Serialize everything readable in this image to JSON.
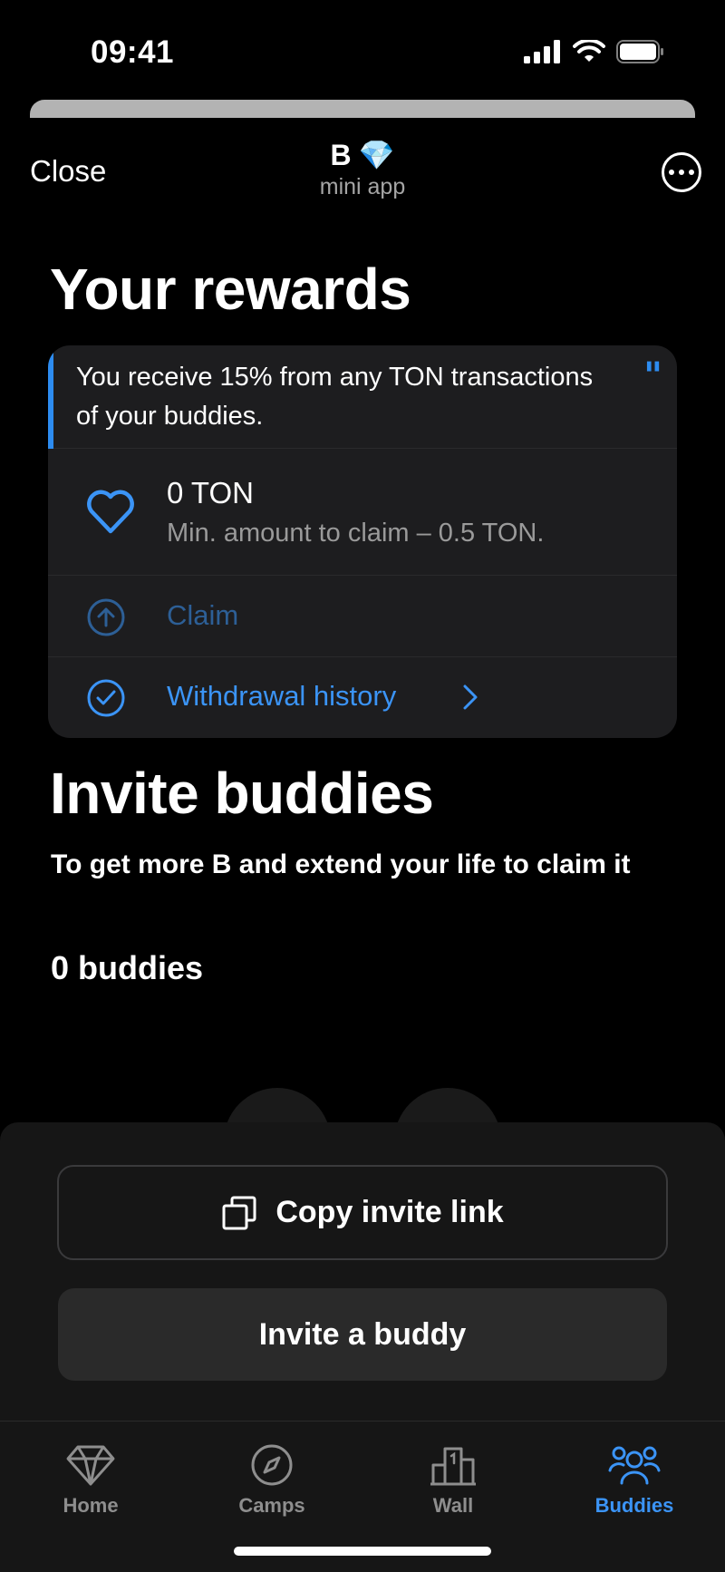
{
  "status": {
    "time": "09:41"
  },
  "header": {
    "close_label": "Close",
    "app_name": "B",
    "app_emoji": "💎",
    "app_subtitle": "mini app"
  },
  "rewards": {
    "title": "Your rewards",
    "quote": "You receive 15% from any TON transactions of your buddies.",
    "amount": "0 TON",
    "min_claim": "Min. amount to claim – 0.5 TON.",
    "claim_label": "Claim",
    "history_label": "Withdrawal history"
  },
  "invite": {
    "title": "Invite buddies",
    "subtitle": "To get more B and extend your life to claim it",
    "count": "0 buddies",
    "copy_label": "Copy invite link",
    "invite_label": "Invite a buddy"
  },
  "tabs": [
    {
      "label": "Home",
      "icon": "diamond-icon",
      "active": false
    },
    {
      "label": "Camps",
      "icon": "compass-icon",
      "active": false
    },
    {
      "label": "Wall",
      "icon": "leaderboard-icon",
      "active": false
    },
    {
      "label": "Buddies",
      "icon": "buddies-icon",
      "active": true
    }
  ],
  "colors": {
    "accent": "#3b94f6",
    "background": "#000000",
    "card": "#1d1d1f"
  }
}
